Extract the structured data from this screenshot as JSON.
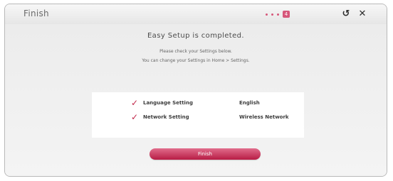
{
  "window": {
    "title": "Finish",
    "step_indicator": "4"
  },
  "content": {
    "heading": "Easy Setup is completed.",
    "line1": "Please check your Settings below.",
    "line2": "You can change your Settings in Home > Settings."
  },
  "summary": [
    {
      "label": "Language Setting",
      "value": "English"
    },
    {
      "label": "Network Setting",
      "value": "Wireless Network"
    }
  ],
  "buttons": {
    "back_icon": "back-icon",
    "close_icon": "close-icon",
    "finish": "Finish"
  },
  "colors": {
    "accent": "#c2284b",
    "button": "#d6577a"
  }
}
